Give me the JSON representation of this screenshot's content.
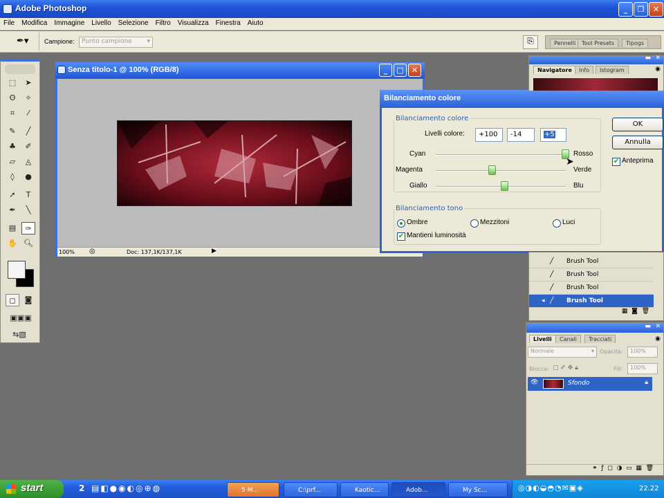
{
  "app": {
    "title": "Adobe Photoshop"
  },
  "menu": [
    "File",
    "Modifica",
    "Immagine",
    "Livello",
    "Selezione",
    "Filtro",
    "Visualizza",
    "Finestra",
    "Aiuto"
  ],
  "options": {
    "sample_label": "Campione:",
    "sample_value": "Punto campione",
    "well_tabs": [
      "Pennelli",
      "Tool Presets",
      "Tipogs"
    ]
  },
  "document": {
    "title": "Senza titolo-1 @ 100% (RGB/8)",
    "zoom": "100%",
    "doc_size": "Doc: 137,1K/137,1K"
  },
  "dialog": {
    "title": "Bilanciamento colore",
    "group1": "Bilanciamento colore",
    "levels_label": "Livelli colore:",
    "levels": [
      "+100",
      "-14",
      "+5"
    ],
    "sliders": [
      {
        "left": "Cyan",
        "right": "Rosso",
        "value": 100
      },
      {
        "left": "Magenta",
        "right": "Verde",
        "value": -14
      },
      {
        "left": "Giallo",
        "right": "Blu",
        "value": 5
      }
    ],
    "group2": "Bilanciamento tono",
    "tones": [
      "Ombre",
      "Mezzitoni",
      "Luci"
    ],
    "selected_tone": "Ombre",
    "preserve_label": "Mantieni luminosità",
    "ok": "OK",
    "cancel": "Annulla",
    "preview_label": "Anteprima"
  },
  "navigator": {
    "tabs": [
      "Navigatore",
      "Info",
      "Istogram"
    ]
  },
  "history": {
    "items": [
      "Brush Tool",
      "Brush Tool",
      "Brush Tool",
      "Brush Tool"
    ],
    "selected_index": 3
  },
  "layers": {
    "tabs": [
      "Livelli",
      "Canali",
      "Tracciati"
    ],
    "blend": "Normale",
    "opacity_label": "Opacità:",
    "opacity": "100%",
    "lock_label": "Blocca:",
    "fill_label": "Fill:",
    "fill": "100%",
    "layer_name": "Sfondo"
  },
  "taskbar": {
    "start": "start",
    "count": "2",
    "tasks": [
      "5 M...",
      "C:\\prf...",
      "Kaotic...",
      "Adob...",
      "My Sc..."
    ],
    "clock": "22.22"
  },
  "colors": {
    "titlebar": "#2157d4",
    "selection": "#2f63c6",
    "accent_green": "#21a121",
    "canvas_red": "#8a1020"
  }
}
